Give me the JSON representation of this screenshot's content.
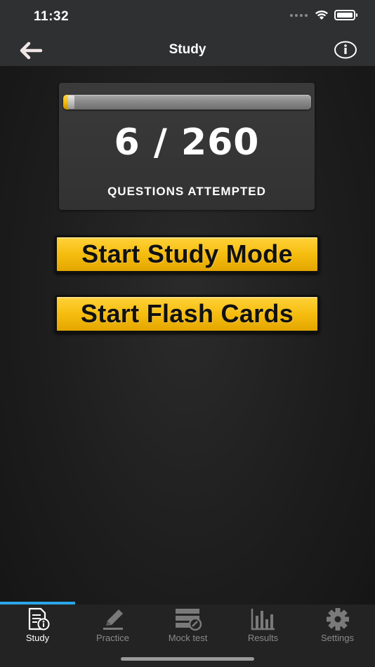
{
  "status_bar": {
    "time": "11:32"
  },
  "nav": {
    "title": "Study"
  },
  "progress": {
    "attempted": 6,
    "total": 260,
    "text": "6 / 260",
    "caption": "QUESTIONS ATTEMPTED",
    "fill_fraction": 0.023
  },
  "buttons": {
    "study_mode": "Start Study Mode",
    "flash_cards": "Start Flash Cards"
  },
  "tabs": [
    {
      "label": "Study",
      "icon": "study-document-icon",
      "active": true
    },
    {
      "label": "Practice",
      "icon": "pencil-icon",
      "active": false
    },
    {
      "label": "Mock test",
      "icon": "mock-test-icon",
      "active": false
    },
    {
      "label": "Results",
      "icon": "bar-chart-icon",
      "active": false
    },
    {
      "label": "Settings",
      "icon": "gear-icon",
      "active": false
    }
  ],
  "colors": {
    "accent_yellow": "#f6bd0f",
    "tab_indicator": "#2aa6e8",
    "bar_background": "#2f3032"
  }
}
